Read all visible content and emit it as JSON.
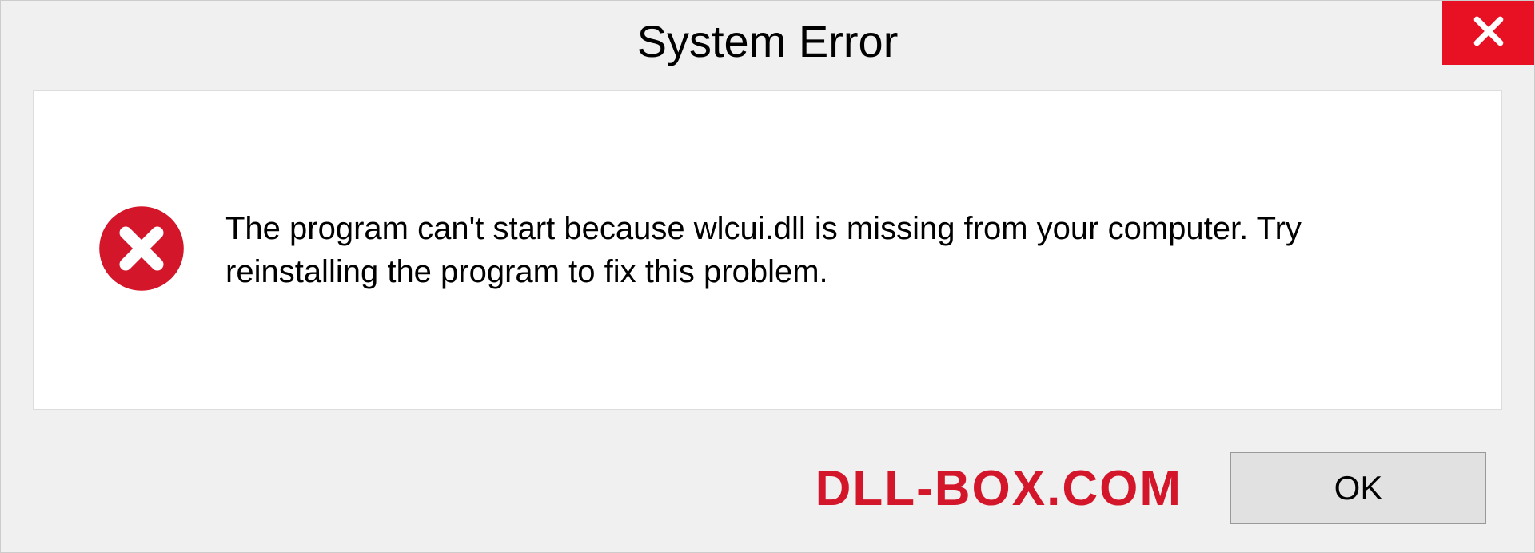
{
  "dialog": {
    "title": "System Error",
    "message": "The program can't start because wlcui.dll is missing from your computer. Try reinstalling the program to fix this problem.",
    "ok_label": "OK"
  },
  "watermark": "DLL-BOX.COM"
}
